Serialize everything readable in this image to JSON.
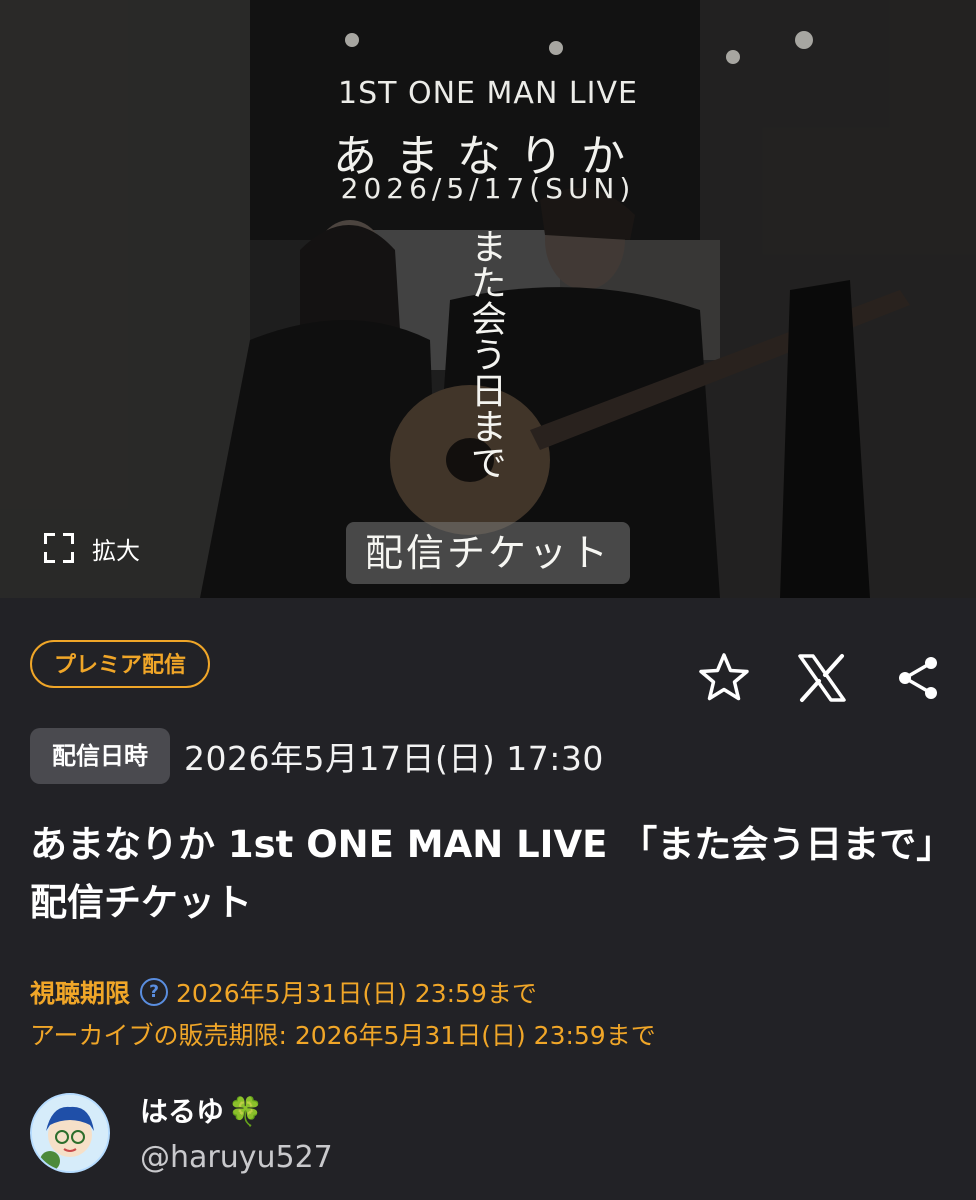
{
  "hero": {
    "poster_subtitle": "1ST ONE MAN LIVE",
    "poster_artist": "あまなりか",
    "poster_date": "2026/5/17(SUN)",
    "poster_vertical": "また会う日まで",
    "poster_ticket": "配信チケット",
    "zoom_label": "拡大"
  },
  "badge": "プレミア配信",
  "actions": {
    "favorite_icon": "star-icon",
    "x_icon": "x-logo-icon",
    "share_icon": "share-icon"
  },
  "schedule": {
    "label": "配信日時",
    "value": "2026年5月17日(日) 17:30"
  },
  "title": "あまなりか 1st ONE MAN LIVE 「また会う日まで」配信チケット",
  "viewing": {
    "label": "視聴期限",
    "value": "2026年5月31日(日) 23:59まで"
  },
  "archive": "アーカイブの販売期限: 2026年5月31日(日) 23:59まで",
  "user": {
    "name": "はるゆ",
    "emoji": "🍀",
    "handle": "@haruyu527"
  },
  "colors": {
    "background": "#222226",
    "accent": "#f0a628",
    "label_bg": "#4a4a4f",
    "help": "#5a8ee0"
  }
}
